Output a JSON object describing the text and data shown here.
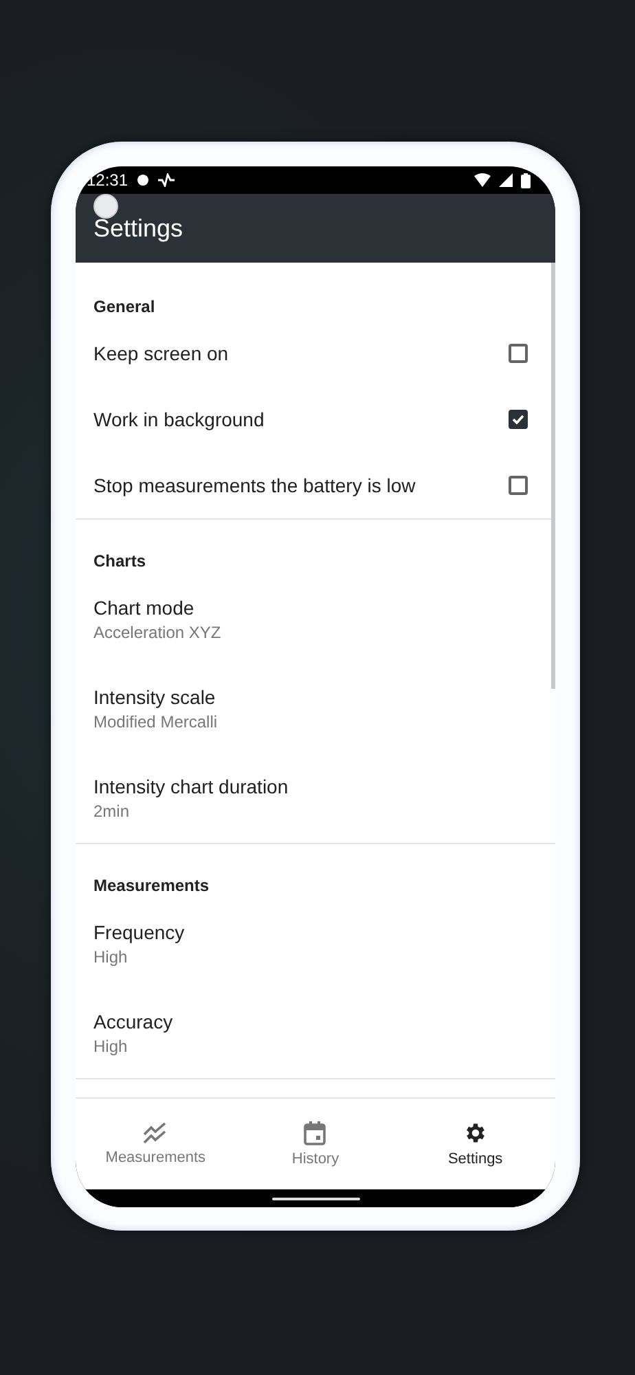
{
  "status_bar": {
    "time": "12:31"
  },
  "app_bar": {
    "title": "Settings"
  },
  "sections": [
    {
      "title": "General",
      "items": [
        {
          "kind": "checkbox",
          "label": "Keep screen on",
          "checked": false
        },
        {
          "kind": "checkbox",
          "label": "Work in background",
          "checked": true
        },
        {
          "kind": "checkbox",
          "label": "Stop measurements the battery is low",
          "checked": false
        }
      ]
    },
    {
      "title": "Charts",
      "items": [
        {
          "kind": "choice",
          "label": "Chart mode",
          "value": "Acceleration XYZ"
        },
        {
          "kind": "choice",
          "label": "Intensity scale",
          "value": "Modified Mercalli"
        },
        {
          "kind": "choice",
          "label": "Intensity chart duration",
          "value": "2min"
        }
      ]
    },
    {
      "title": "Measurements",
      "items": [
        {
          "kind": "choice",
          "label": "Frequency",
          "value": "High"
        },
        {
          "kind": "choice",
          "label": "Accuracy",
          "value": "High"
        }
      ]
    }
  ],
  "bottom_nav": [
    {
      "kind": "chart",
      "label": "Measurements",
      "selected": false
    },
    {
      "kind": "calendar",
      "label": "History",
      "selected": false
    },
    {
      "kind": "gear",
      "label": "Settings",
      "selected": true
    }
  ]
}
